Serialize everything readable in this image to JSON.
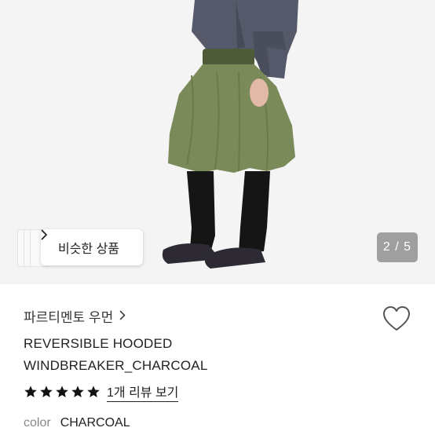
{
  "hero": {
    "similar_button_label": "비슷한 상품",
    "page_indicator": "2 / 5"
  },
  "product": {
    "brand": "파르티멘토 우먼",
    "title_line1": "REVERSIBLE HOODED",
    "title_line2": "WINDBREAKER_CHARCOAL",
    "rating_stars": 5,
    "review_link_label": "1개 리뷰 보기",
    "color_label": "color",
    "color_value": "CHARCOAL"
  },
  "colors": {
    "photo_background": "#f4f4f4",
    "star": "#111111",
    "overlay_badge": "rgba(0,0,0,0.35)"
  },
  "icons": {
    "similar_chevron": "chevron-right-icon",
    "brand_chevron": "chevron-right-icon",
    "wishlist": "heart-outline-icon",
    "rating": "star-filled-icon"
  }
}
